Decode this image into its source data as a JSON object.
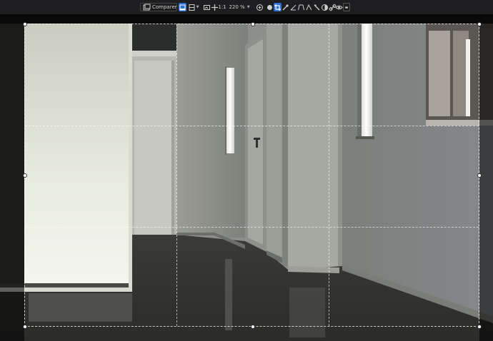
{
  "toolbar": {
    "compare_label": "Comparer",
    "zoom_ratio": "1:1",
    "zoom_value": "220 %",
    "icons": [
      "compare-icon",
      "single-view-icon",
      "split-view-icon",
      "crop-icon",
      "move-icon",
      "zoom-in-icon",
      "hand-icon",
      "eyedropper-icon",
      "crop-tool-icon",
      "brush-icon",
      "perspective-icon",
      "gradient-icon",
      "adjust-icon",
      "link-icon",
      "eye-icon",
      "display-icon"
    ]
  },
  "colors": {
    "toolbar_bg": "#1e1e20",
    "accent": "#2e6fd6",
    "canvas_bg": "#141416"
  }
}
